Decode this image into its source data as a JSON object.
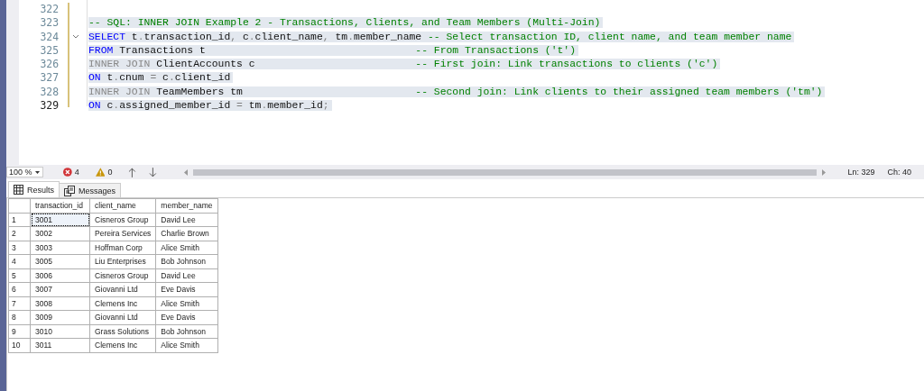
{
  "editor": {
    "lines": [
      {
        "number": "322",
        "current": false
      },
      {
        "number": "323",
        "current": false,
        "selected": true,
        "tokens": [
          {
            "kind": "comment",
            "text": "-- SQL: INNER JOIN Example 2 - Transactions, Clients, and Team Members (Multi-Join)"
          }
        ]
      },
      {
        "number": "324",
        "current": false,
        "selected": true,
        "fold": true,
        "tokens": [
          {
            "kind": "keyword",
            "text": "SELECT"
          },
          {
            "kind": "plain",
            "text": " t"
          },
          {
            "kind": "op",
            "text": "."
          },
          {
            "kind": "plain",
            "text": "transaction_id"
          },
          {
            "kind": "op",
            "text": ","
          },
          {
            "kind": "plain",
            "text": " c"
          },
          {
            "kind": "op",
            "text": "."
          },
          {
            "kind": "plain",
            "text": "client_name"
          },
          {
            "kind": "op",
            "text": ","
          },
          {
            "kind": "plain",
            "text": " tm"
          },
          {
            "kind": "op",
            "text": "."
          },
          {
            "kind": "plain",
            "text": "member_name "
          },
          {
            "kind": "comment",
            "text": "-- Select transaction ID, client name, and team member name"
          }
        ]
      },
      {
        "number": "325",
        "current": false,
        "selected": true,
        "tokens": [
          {
            "kind": "keyword",
            "text": "FROM"
          },
          {
            "kind": "plain",
            "text": " Transactions t                                  "
          },
          {
            "kind": "comment",
            "text": "-- From Transactions ('t')"
          }
        ]
      },
      {
        "number": "326",
        "current": false,
        "selected": true,
        "tokens": [
          {
            "kind": "join",
            "text": "INNER JOIN"
          },
          {
            "kind": "plain",
            "text": " ClientAccounts c                          "
          },
          {
            "kind": "comment",
            "text": "-- First join: Link transactions to clients ('c')"
          }
        ]
      },
      {
        "number": "327",
        "current": false,
        "selected": true,
        "tokens": [
          {
            "kind": "keyword",
            "text": "ON"
          },
          {
            "kind": "plain",
            "text": " t"
          },
          {
            "kind": "op",
            "text": "."
          },
          {
            "kind": "plain",
            "text": "cnum "
          },
          {
            "kind": "op",
            "text": "="
          },
          {
            "kind": "plain",
            "text": " c"
          },
          {
            "kind": "op",
            "text": "."
          },
          {
            "kind": "plain",
            "text": "client_id"
          }
        ]
      },
      {
        "number": "328",
        "current": false,
        "selected": true,
        "tokens": [
          {
            "kind": "join",
            "text": "INNER JOIN"
          },
          {
            "kind": "plain",
            "text": " TeamMembers tm                            "
          },
          {
            "kind": "comment",
            "text": "-- Second join: Link clients to their assigned team members ('tm')"
          }
        ]
      },
      {
        "number": "329",
        "current": true,
        "selected": true,
        "tokens": [
          {
            "kind": "keyword",
            "text": "ON"
          },
          {
            "kind": "plain",
            "text": " c"
          },
          {
            "kind": "op",
            "text": "."
          },
          {
            "kind": "plain",
            "text": "assigned_member_id "
          },
          {
            "kind": "op",
            "text": "="
          },
          {
            "kind": "plain",
            "text": " tm"
          },
          {
            "kind": "op",
            "text": "."
          },
          {
            "kind": "plain",
            "text": "member_id"
          },
          {
            "kind": "op",
            "text": ";"
          }
        ]
      }
    ]
  },
  "status_bar": {
    "zoom": "100 %",
    "errors": "4",
    "warnings": "0",
    "line": "Ln: 329",
    "column": "Ch: 40"
  },
  "tabs": [
    {
      "label": "Results",
      "selected": true
    },
    {
      "label": "Messages",
      "selected": false
    }
  ],
  "results": {
    "columns": [
      "transaction_id",
      "client_name",
      "member_name"
    ],
    "rows": [
      {
        "number": "1",
        "focused": true,
        "cells": [
          "3001",
          "Cisneros Group",
          "David Lee"
        ]
      },
      {
        "number": "2",
        "focused": false,
        "cells": [
          "3002",
          "Pereira Services",
          "Charlie Brown"
        ]
      },
      {
        "number": "3",
        "focused": false,
        "cells": [
          "3003",
          "Hoffman Corp",
          "Alice Smith"
        ]
      },
      {
        "number": "4",
        "focused": false,
        "cells": [
          "3005",
          "Liu Enterprises",
          "Bob Johnson"
        ]
      },
      {
        "number": "5",
        "focused": false,
        "cells": [
          "3006",
          "Cisneros Group",
          "David Lee"
        ]
      },
      {
        "number": "6",
        "focused": false,
        "cells": [
          "3007",
          "Giovanni Ltd",
          "Eve Davis"
        ]
      },
      {
        "number": "7",
        "focused": false,
        "cells": [
          "3008",
          "Clemens Inc",
          "Alice Smith"
        ]
      },
      {
        "number": "8",
        "focused": false,
        "cells": [
          "3009",
          "Giovanni Ltd",
          "Eve Davis"
        ]
      },
      {
        "number": "9",
        "focused": false,
        "cells": [
          "3010",
          "Grass Solutions",
          "Bob Johnson"
        ]
      },
      {
        "number": "10",
        "focused": false,
        "cells": [
          "3011",
          "Clemens Inc",
          "Alice Smith"
        ]
      }
    ]
  }
}
